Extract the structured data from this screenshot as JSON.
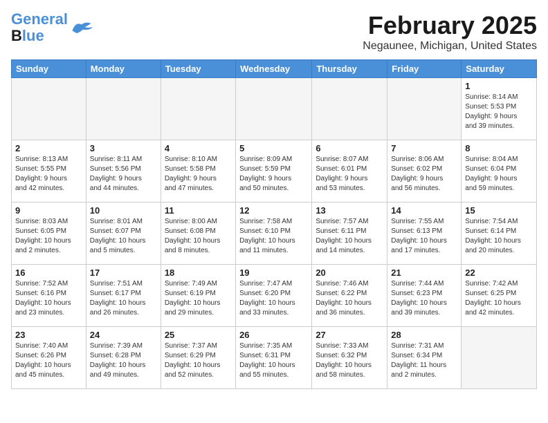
{
  "header": {
    "logo_line1": "General",
    "logo_line2": "Blue",
    "month_title": "February 2025",
    "location": "Negaunee, Michigan, United States"
  },
  "weekdays": [
    "Sunday",
    "Monday",
    "Tuesday",
    "Wednesday",
    "Thursday",
    "Friday",
    "Saturday"
  ],
  "weeks": [
    [
      {
        "day": "",
        "info": ""
      },
      {
        "day": "",
        "info": ""
      },
      {
        "day": "",
        "info": ""
      },
      {
        "day": "",
        "info": ""
      },
      {
        "day": "",
        "info": ""
      },
      {
        "day": "",
        "info": ""
      },
      {
        "day": "1",
        "info": "Sunrise: 8:14 AM\nSunset: 5:53 PM\nDaylight: 9 hours\nand 39 minutes."
      }
    ],
    [
      {
        "day": "2",
        "info": "Sunrise: 8:13 AM\nSunset: 5:55 PM\nDaylight: 9 hours\nand 42 minutes."
      },
      {
        "day": "3",
        "info": "Sunrise: 8:11 AM\nSunset: 5:56 PM\nDaylight: 9 hours\nand 44 minutes."
      },
      {
        "day": "4",
        "info": "Sunrise: 8:10 AM\nSunset: 5:58 PM\nDaylight: 9 hours\nand 47 minutes."
      },
      {
        "day": "5",
        "info": "Sunrise: 8:09 AM\nSunset: 5:59 PM\nDaylight: 9 hours\nand 50 minutes."
      },
      {
        "day": "6",
        "info": "Sunrise: 8:07 AM\nSunset: 6:01 PM\nDaylight: 9 hours\nand 53 minutes."
      },
      {
        "day": "7",
        "info": "Sunrise: 8:06 AM\nSunset: 6:02 PM\nDaylight: 9 hours\nand 56 minutes."
      },
      {
        "day": "8",
        "info": "Sunrise: 8:04 AM\nSunset: 6:04 PM\nDaylight: 9 hours\nand 59 minutes."
      }
    ],
    [
      {
        "day": "9",
        "info": "Sunrise: 8:03 AM\nSunset: 6:05 PM\nDaylight: 10 hours\nand 2 minutes."
      },
      {
        "day": "10",
        "info": "Sunrise: 8:01 AM\nSunset: 6:07 PM\nDaylight: 10 hours\nand 5 minutes."
      },
      {
        "day": "11",
        "info": "Sunrise: 8:00 AM\nSunset: 6:08 PM\nDaylight: 10 hours\nand 8 minutes."
      },
      {
        "day": "12",
        "info": "Sunrise: 7:58 AM\nSunset: 6:10 PM\nDaylight: 10 hours\nand 11 minutes."
      },
      {
        "day": "13",
        "info": "Sunrise: 7:57 AM\nSunset: 6:11 PM\nDaylight: 10 hours\nand 14 minutes."
      },
      {
        "day": "14",
        "info": "Sunrise: 7:55 AM\nSunset: 6:13 PM\nDaylight: 10 hours\nand 17 minutes."
      },
      {
        "day": "15",
        "info": "Sunrise: 7:54 AM\nSunset: 6:14 PM\nDaylight: 10 hours\nand 20 minutes."
      }
    ],
    [
      {
        "day": "16",
        "info": "Sunrise: 7:52 AM\nSunset: 6:16 PM\nDaylight: 10 hours\nand 23 minutes."
      },
      {
        "day": "17",
        "info": "Sunrise: 7:51 AM\nSunset: 6:17 PM\nDaylight: 10 hours\nand 26 minutes."
      },
      {
        "day": "18",
        "info": "Sunrise: 7:49 AM\nSunset: 6:19 PM\nDaylight: 10 hours\nand 29 minutes."
      },
      {
        "day": "19",
        "info": "Sunrise: 7:47 AM\nSunset: 6:20 PM\nDaylight: 10 hours\nand 33 minutes."
      },
      {
        "day": "20",
        "info": "Sunrise: 7:46 AM\nSunset: 6:22 PM\nDaylight: 10 hours\nand 36 minutes."
      },
      {
        "day": "21",
        "info": "Sunrise: 7:44 AM\nSunset: 6:23 PM\nDaylight: 10 hours\nand 39 minutes."
      },
      {
        "day": "22",
        "info": "Sunrise: 7:42 AM\nSunset: 6:25 PM\nDaylight: 10 hours\nand 42 minutes."
      }
    ],
    [
      {
        "day": "23",
        "info": "Sunrise: 7:40 AM\nSunset: 6:26 PM\nDaylight: 10 hours\nand 45 minutes."
      },
      {
        "day": "24",
        "info": "Sunrise: 7:39 AM\nSunset: 6:28 PM\nDaylight: 10 hours\nand 49 minutes."
      },
      {
        "day": "25",
        "info": "Sunrise: 7:37 AM\nSunset: 6:29 PM\nDaylight: 10 hours\nand 52 minutes."
      },
      {
        "day": "26",
        "info": "Sunrise: 7:35 AM\nSunset: 6:31 PM\nDaylight: 10 hours\nand 55 minutes."
      },
      {
        "day": "27",
        "info": "Sunrise: 7:33 AM\nSunset: 6:32 PM\nDaylight: 10 hours\nand 58 minutes."
      },
      {
        "day": "28",
        "info": "Sunrise: 7:31 AM\nSunset: 6:34 PM\nDaylight: 11 hours\nand 2 minutes."
      },
      {
        "day": "",
        "info": ""
      }
    ]
  ]
}
